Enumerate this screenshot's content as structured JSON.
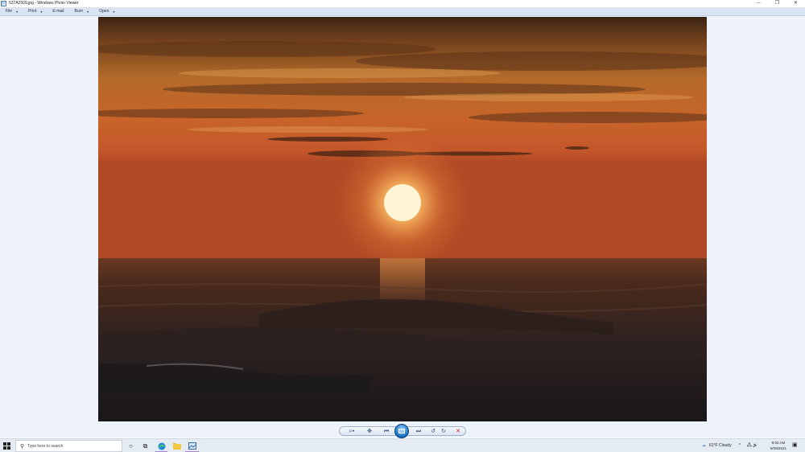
{
  "window": {
    "title": "537A2509.jpg - Windows Photo Viewer",
    "controls": {
      "minimize": "─",
      "restore": "❐",
      "close": "✕"
    }
  },
  "menu": {
    "items": [
      {
        "label": "File",
        "caret": "▾"
      },
      {
        "label": "Print",
        "caret": "▾"
      },
      {
        "label": "E-mail",
        "caret": ""
      },
      {
        "label": "Burn",
        "caret": "▾"
      },
      {
        "label": "Open",
        "caret": "▾"
      }
    ]
  },
  "controls": {
    "zoom": "⌕▾",
    "actual_size": "✥",
    "previous": "⏮",
    "next": "⏭",
    "rotate_ccw": "↺",
    "rotate_cw": "↻",
    "delete": "✕",
    "colors": {
      "accent": "#1a6fc2",
      "delete": "#c42b1c"
    }
  },
  "taskbar": {
    "search_placeholder": "Type here to search",
    "search_icon": "⚲",
    "cortana": "○",
    "task_view": "⧉",
    "weather_icon": "☁",
    "weather": "61°F  Cloudy",
    "tray_chevron": "^",
    "tray_icons": "🖧 🔊",
    "time": "9:02 AM",
    "date": "8/29/2021",
    "notification": "▣"
  }
}
